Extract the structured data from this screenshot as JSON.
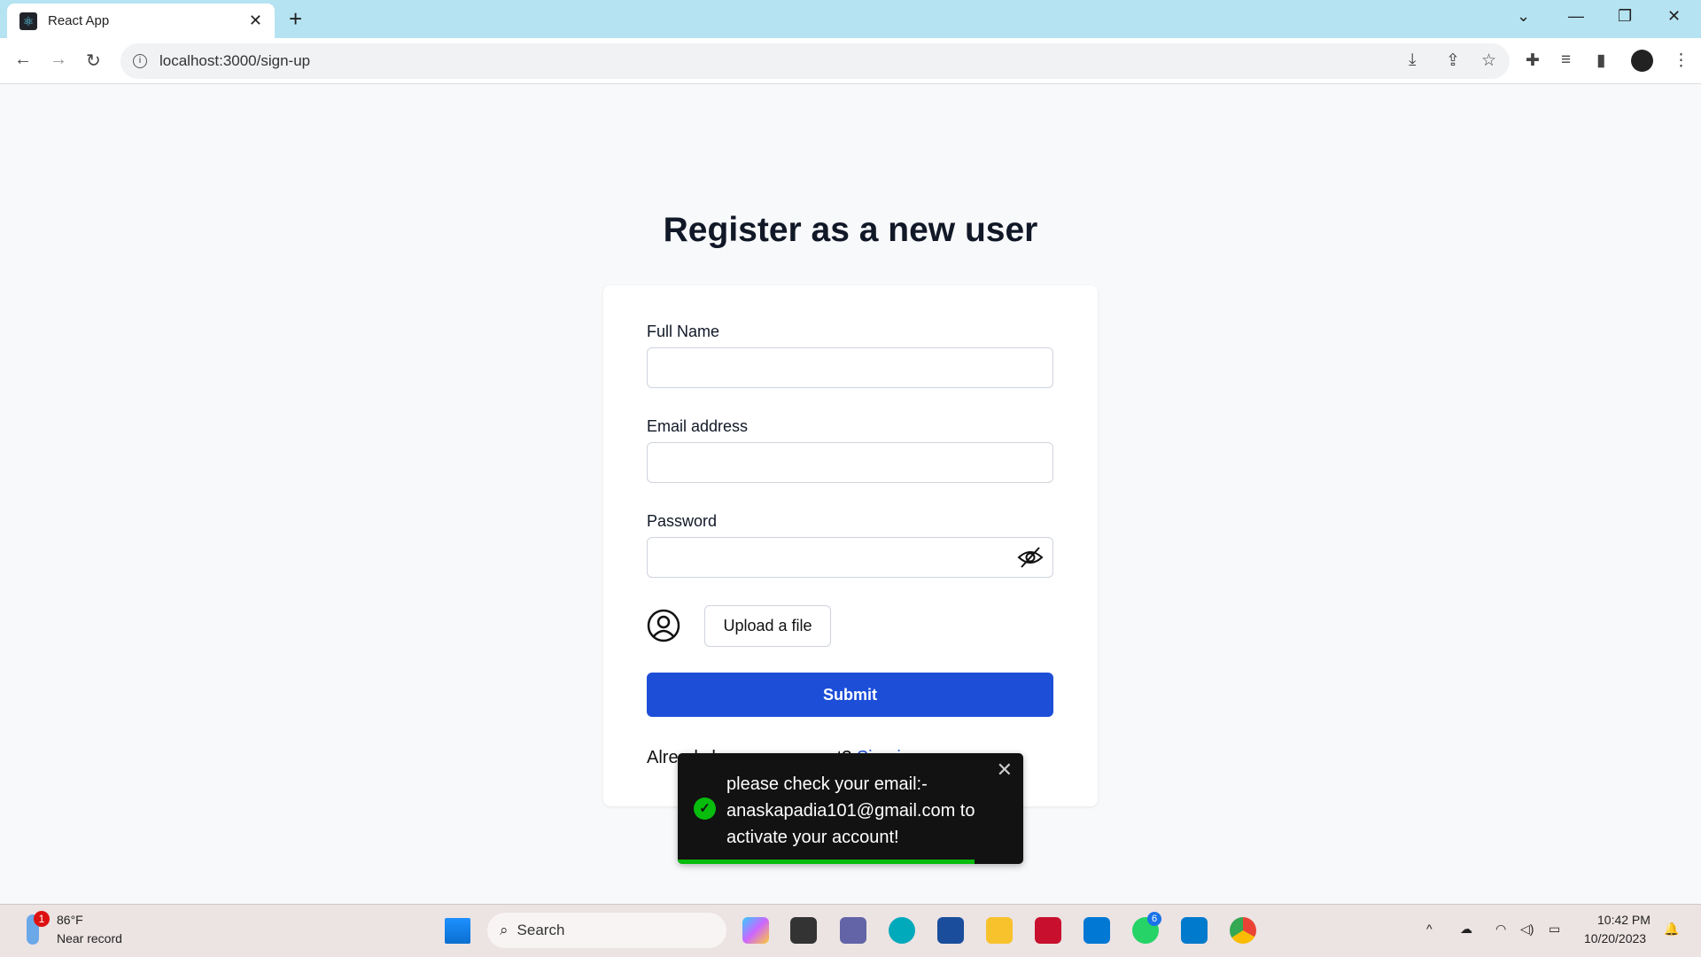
{
  "browser": {
    "tab_title": "React App",
    "url": "localhost:3000/sign-up"
  },
  "page": {
    "title": "Register as a new user",
    "full_name_label": "Full Name",
    "full_name_value": "",
    "email_label": "Email address",
    "email_value": "",
    "password_label": "Password",
    "password_value": "",
    "upload_label": "Upload a file",
    "submit_label": "Submit",
    "already_text": "Already have an account?",
    "signin_label": "Sign in"
  },
  "toast": {
    "message": "please check your email:- anaskapadia101@gmail.com to activate your account!",
    "progress_percent": 86,
    "type": "success"
  },
  "taskbar": {
    "weather_temp": "86°F",
    "weather_desc": "Near record",
    "weather_badge": "1",
    "search_label": "Search",
    "whatsapp_badge": "6",
    "time": "10:42 PM",
    "date": "10/20/2023"
  },
  "colors": {
    "primary": "#1d4ed8",
    "toast_bg": "#121212",
    "success": "#07bc0c"
  }
}
